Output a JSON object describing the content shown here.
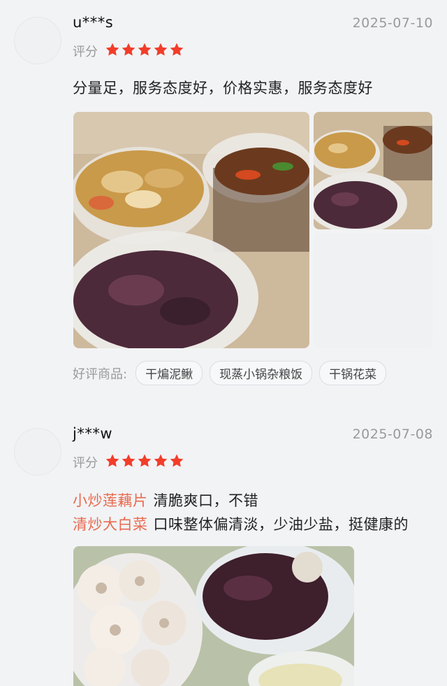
{
  "reviews": [
    {
      "username": "u***s",
      "date": "2025-07-10",
      "rating_label": "评分",
      "stars": 5,
      "text": "分量足，服务态度好，价格实惠，服务态度好",
      "good_items_label": "好评商品:",
      "good_items": [
        "干煸泥鳅",
        "现蒸小锅杂粮饭",
        "干锅花菜"
      ]
    },
    {
      "username": "j***w",
      "date": "2025-07-08",
      "rating_label": "评分",
      "stars": 5,
      "dish_comments": [
        {
          "dish": "小炒莲藕片",
          "comment": "清脆爽口，不错"
        },
        {
          "dish": "清炒大白菜",
          "comment": "口味整体偏清淡，少油少盐，挺健康的"
        }
      ]
    }
  ],
  "colors": {
    "star": "#f23d2a",
    "dish_highlight": "#e86a4f",
    "background": "#f2f3f5"
  }
}
